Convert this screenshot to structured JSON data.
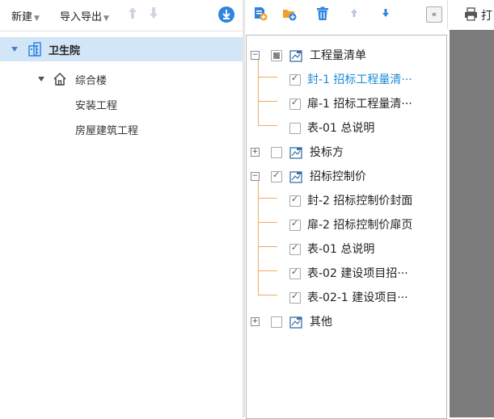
{
  "left_toolbar": {
    "new_label": "新建",
    "import_export_label": "导入导出",
    "up_icon": "arrow-up-icon",
    "down_icon": "arrow-down-icon",
    "download_icon": "download-circle-icon"
  },
  "project_tree": {
    "root": {
      "label": "卫生院",
      "icon": "building-icon"
    },
    "child": {
      "label": "综合楼",
      "icon": "home-icon"
    },
    "leaves": [
      "安装工程",
      "房屋建筑工程"
    ]
  },
  "report_toolbar": {
    "icons": [
      "add-report-icon",
      "add-folder-icon",
      "delete-icon",
      "move-up-icon",
      "move-down-icon"
    ],
    "collapse_label": "«"
  },
  "report_tree": [
    {
      "label": "工程量清单",
      "level": 0,
      "expanded": true,
      "check": "partial",
      "folder": true
    },
    {
      "label": "封-1 招标工程量清···",
      "level": 1,
      "check": "checked",
      "active": true
    },
    {
      "label": "扉-1 招标工程量清···",
      "level": 1,
      "check": "checked"
    },
    {
      "label": "表-01 总说明",
      "level": 1,
      "check": "unchecked"
    },
    {
      "label": "投标方",
      "level": 0,
      "expanded": false,
      "check": "unchecked",
      "folder": true
    },
    {
      "label": "招标控制价",
      "level": 0,
      "expanded": true,
      "check": "checked",
      "folder": true
    },
    {
      "label": "封-2 招标控制价封面",
      "level": 1,
      "check": "checked"
    },
    {
      "label": "扉-2 招标控制价扉页",
      "level": 1,
      "check": "checked"
    },
    {
      "label": "表-01 总说明",
      "level": 1,
      "check": "checked"
    },
    {
      "label": "表-02 建设项目招···",
      "level": 1,
      "check": "checked"
    },
    {
      "label": "表-02-1 建设项目···",
      "level": 1,
      "check": "checked"
    },
    {
      "label": "其他",
      "level": 0,
      "expanded": false,
      "check": "unchecked",
      "folder": true
    }
  ],
  "print": {
    "label": "打",
    "icon": "printer-icon"
  },
  "colors": {
    "accent": "#1b8ad6",
    "selected_bg": "#d3e6f8",
    "tree_line": "#f0a868",
    "preview_bg": "#7c7c7c"
  }
}
